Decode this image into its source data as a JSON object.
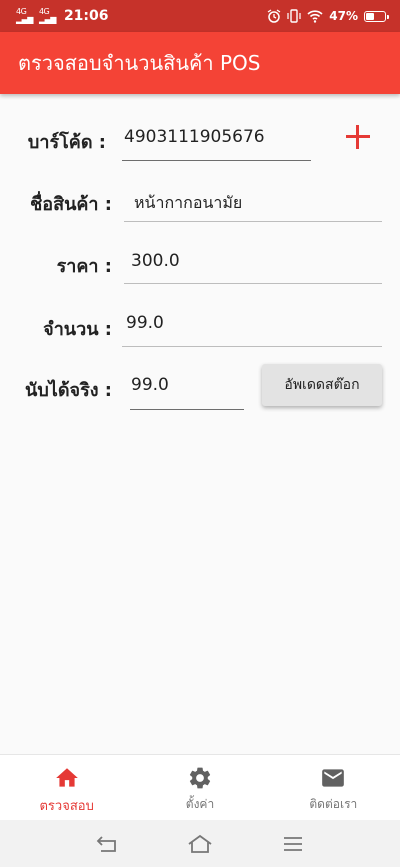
{
  "status_bar": {
    "signal_1": "4G",
    "signal_2": "4G",
    "time": "21:06",
    "battery_percent": "47%",
    "battery_level": 0.47
  },
  "app_bar": {
    "title": "ตรวจสอบจำนวนสินค้า POS"
  },
  "form": {
    "barcode_label": "บาร์โค้ด :",
    "barcode_value": "4903111905676",
    "name_label": "ชื่อสินค้า :",
    "name_value": "หน้ากากอนามัย",
    "price_label": "ราคา :",
    "price_value": "300.0",
    "qty_label": "จำนวน :",
    "qty_value": "99.0",
    "counted_label": "นับได้จริง :",
    "counted_value": "99.0",
    "update_button": "อัพเดดสต๊อก"
  },
  "bottom_nav": {
    "items": [
      {
        "label": "ตรวจสอบ",
        "icon": "home-icon"
      },
      {
        "label": "ตั้งค่า",
        "icon": "gear-icon"
      },
      {
        "label": "ติดต่อเรา",
        "icon": "mail-icon"
      }
    ],
    "active_color": "#e53935"
  },
  "colors": {
    "app_bar": "#f44336",
    "status_bar": "#c6322a",
    "accent": "#e53935"
  }
}
